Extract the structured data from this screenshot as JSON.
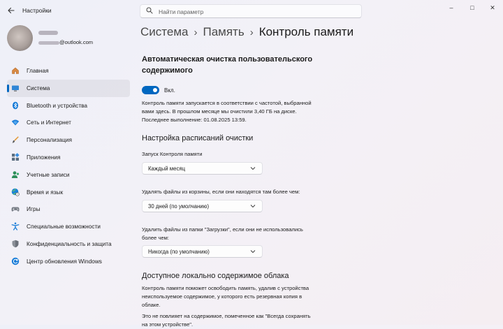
{
  "window": {
    "title": "Настройки",
    "controls": {
      "minimize": "–",
      "maximize": "□",
      "close": "✕"
    }
  },
  "search": {
    "placeholder": "Найти параметр"
  },
  "account": {
    "email_suffix": "@outlook.com"
  },
  "sidebar": {
    "items": [
      {
        "label": "Главная",
        "icon": "home-icon",
        "active": false
      },
      {
        "label": "Система",
        "icon": "system-icon",
        "active": true
      },
      {
        "label": "Bluetooth и устройства",
        "icon": "bluetooth-icon",
        "active": false
      },
      {
        "label": "Сеть и Интернет",
        "icon": "wifi-icon",
        "active": false
      },
      {
        "label": "Персонализация",
        "icon": "brush-icon",
        "active": false
      },
      {
        "label": "Приложения",
        "icon": "apps-icon",
        "active": false
      },
      {
        "label": "Учетные записи",
        "icon": "account-icon",
        "active": false
      },
      {
        "label": "Время и язык",
        "icon": "globe-clock-icon",
        "active": false
      },
      {
        "label": "Игры",
        "icon": "gamepad-icon",
        "active": false
      },
      {
        "label": "Специальные возможности",
        "icon": "accessibility-icon",
        "active": false
      },
      {
        "label": "Конфиденциальность и защита",
        "icon": "shield-icon",
        "active": false
      },
      {
        "label": "Центр обновления Windows",
        "icon": "update-icon",
        "active": false
      }
    ]
  },
  "breadcrumb": {
    "part1": "Система",
    "part2": "Память",
    "current": "Контроль памяти",
    "separator": "›"
  },
  "main": {
    "section1_title": "Автоматическая очистка пользовательского содержимого",
    "toggle_label": "Вкл.",
    "toggle_on": true,
    "description_lines": [
      "Контроль памяти запускается в соответствии с частотой, выбранной",
      "вами здесь. В прошлом месяце мы очистили 3,40 ГБ на диске.",
      "Последнее выполнение: 01.08.2025 13:59."
    ],
    "schedule_title": "Настройка расписаний очистки",
    "run_label": "Запуск Контроля памяти",
    "run_value": "Каждый месяц",
    "recycle_label": "Удалять файлы из корзины, если они находятся там более чем:",
    "recycle_value": "30 дней (по умолчанию)",
    "downloads_label_lines": [
      "Удалить файлы из папки \"Загрузки\", если они не использовались",
      "более чем:"
    ],
    "downloads_value": "Никогда (по умолчанию)",
    "cloud_title": "Доступное локально содержимое облака",
    "cloud_desc_lines": [
      "Контроль памяти поможет освободить память, удалив с устройства",
      "неиспользуемое содержимое, у которого есть резервная копия в",
      "облаке."
    ],
    "cloud_note_lines": [
      "Это не повлияет на содержимое, помеченное как \"Всегда сохранять",
      "на этом устройстве\"."
    ]
  },
  "colors": {
    "accent": "#0067c0",
    "background": "#f2f1f7"
  }
}
